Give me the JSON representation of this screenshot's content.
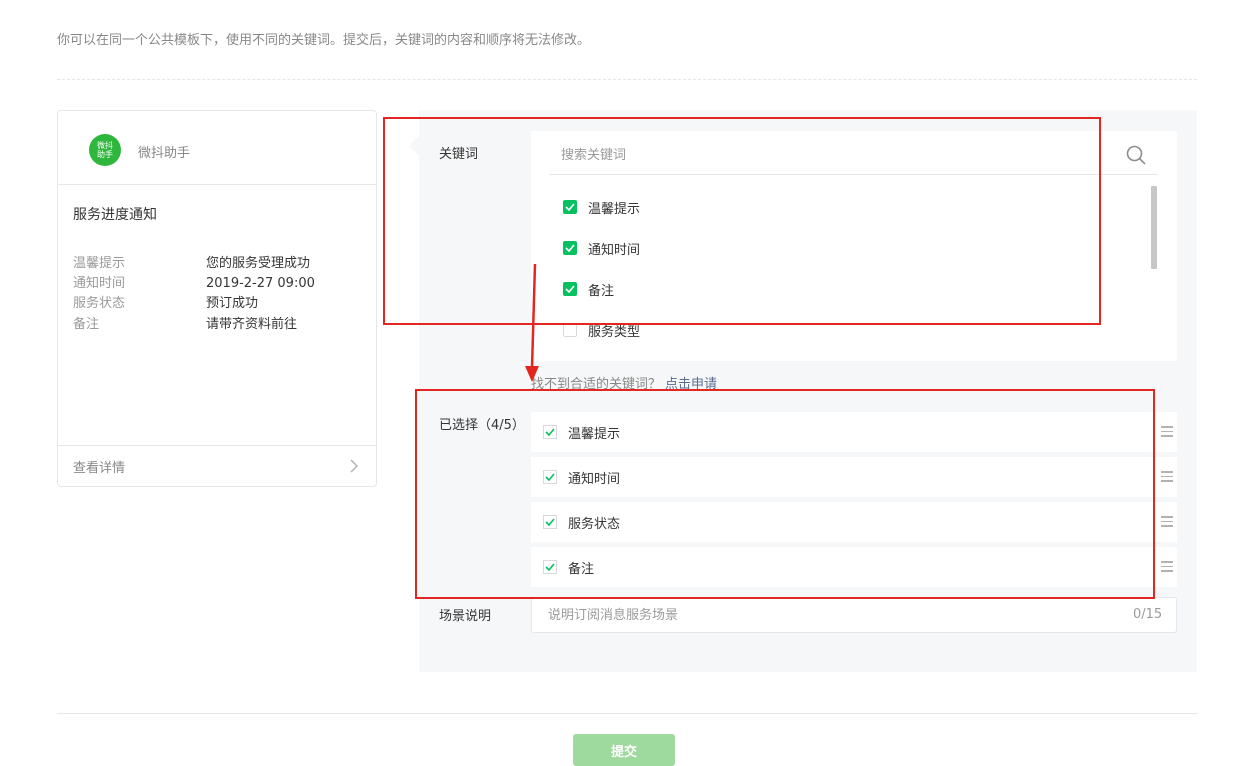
{
  "notice": "你可以在同一个公共模板下，使用不同的关键词。提交后，关键词的内容和顺序将无法修改。",
  "preview": {
    "avatar_text": "微抖助手",
    "account_name": "微抖助手",
    "title": "服务进度通知",
    "fields": [
      {
        "key": "温馨提示",
        "value": "您的服务受理成功"
      },
      {
        "key": "通知时间",
        "value": "2019-2-27 09:00"
      },
      {
        "key": "服务状态",
        "value": "预订成功"
      },
      {
        "key": "备注",
        "value": "请带齐资料前往"
      }
    ],
    "detail_label": "查看详情"
  },
  "keywords": {
    "label": "关键词",
    "search_placeholder": "搜索关键词",
    "options": [
      {
        "label": "温馨提示",
        "checked": true
      },
      {
        "label": "通知时间",
        "checked": true
      },
      {
        "label": "备注",
        "checked": true
      },
      {
        "label": "服务类型",
        "checked": false
      }
    ],
    "help_text": "找不到合适的关键词？",
    "help_link": "点击申请"
  },
  "selected": {
    "label": "已选择（4/5）",
    "items": [
      "温馨提示",
      "通知时间",
      "服务状态",
      "备注"
    ]
  },
  "scene": {
    "label": "场景说明",
    "placeholder": "说明订阅消息服务场景",
    "counter": "0/15"
  },
  "submit_label": "提交",
  "colors": {
    "brand_green": "#07c160",
    "avatar_green": "#2fb73d",
    "submit_disabled": "#9ed99d",
    "link_blue": "#576b95",
    "highlight_red": "#e3261f"
  }
}
